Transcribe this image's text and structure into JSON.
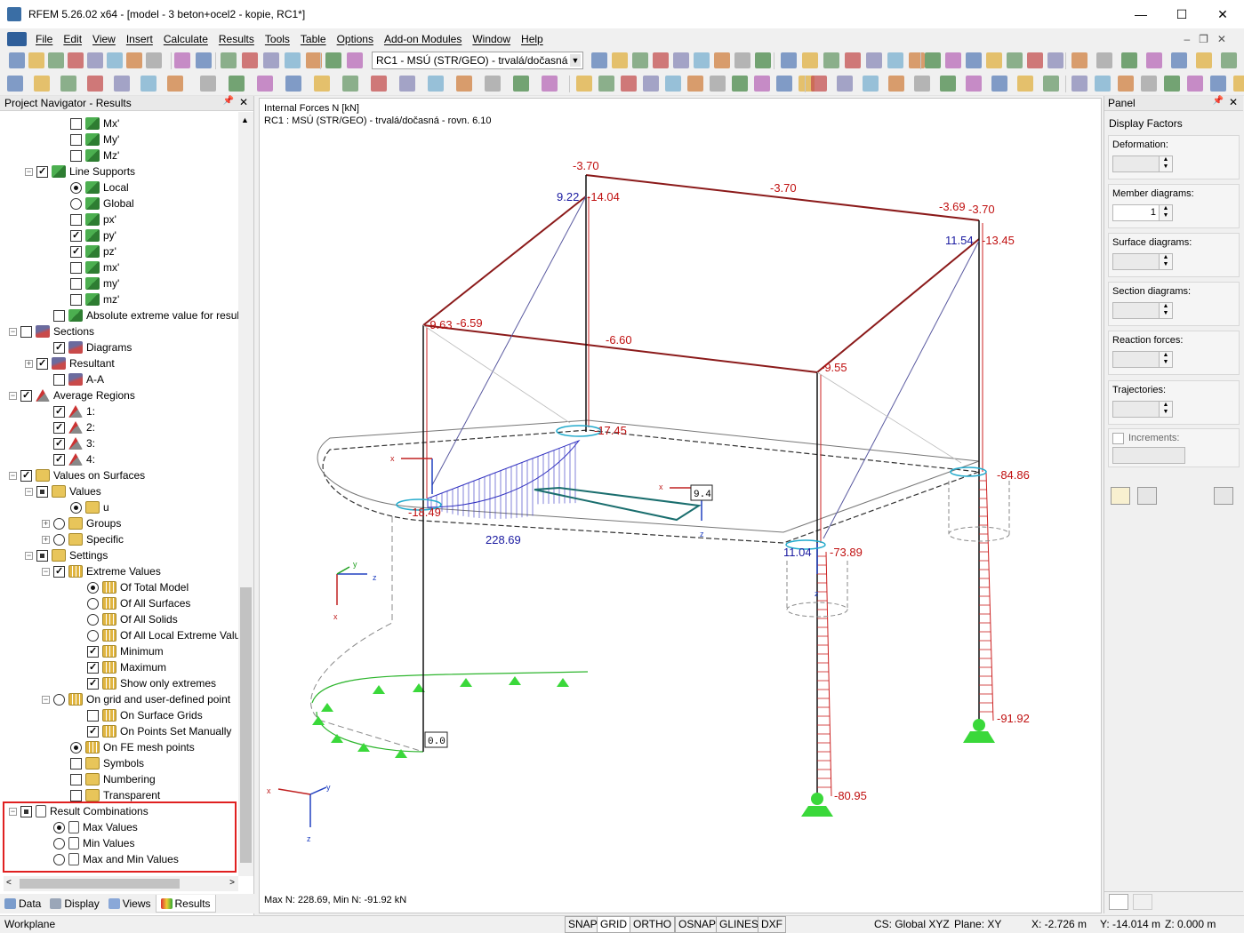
{
  "window": {
    "title": "RFEM 5.26.02 x64 - [model - 3 beton+ocel2 - kopie, RC1*]",
    "controls": [
      "—",
      "☐",
      "✕"
    ]
  },
  "menu": [
    "File",
    "Edit",
    "View",
    "Insert",
    "Calculate",
    "Results",
    "Tools",
    "Table",
    "Options",
    "Add-on Modules",
    "Window",
    "Help"
  ],
  "toolbar": {
    "load_case": "RC1 - MSÚ (STR/GEO) - trvalá/dočasná"
  },
  "navigator": {
    "title": "Project Navigator - Results",
    "items": {
      "mx": "Mx'",
      "my": "My'",
      "mz": "Mz'",
      "line_supports": "Line Supports",
      "local": "Local",
      "global": "Global",
      "px": "px'",
      "py": "py'",
      "pz": "pz'",
      "mx2": "mx'",
      "my2": "my'",
      "mz2": "mz'",
      "absolute": "Absolute extreme value for result c",
      "sections": "Sections",
      "diagrams": "Diagrams",
      "resultant": "Resultant",
      "aa": "A-A",
      "avg_regions": "Average Regions",
      "r1": "1:",
      "r2": "2:",
      "r3": "3:",
      "r4": "4:",
      "values_on_surfaces": "Values on Surfaces",
      "values": "Values",
      "u": "u",
      "groups": "Groups",
      "specific": "Specific",
      "settings": "Settings",
      "extreme_values": "Extreme Values",
      "of_total_model": "Of Total Model",
      "of_all_surfaces": "Of All Surfaces",
      "of_all_solids": "Of All Solids",
      "of_all_local": "Of All Local Extreme Values",
      "minimum": "Minimum",
      "maximum": "Maximum",
      "show_only_extremes": "Show only extremes",
      "on_grid": "On grid and user-defined point",
      "on_surface_grids": "On Surface Grids",
      "on_points_set": "On Points Set Manually",
      "on_fe_mesh": "On FE mesh points",
      "symbols": "Symbols",
      "numbering": "Numbering",
      "transparent": "Transparent",
      "result_combinations": "Result Combinations",
      "max_values": "Max Values",
      "min_values": "Min Values",
      "max_and_min": "Max and Min Values"
    },
    "tabs": [
      "Data",
      "Display",
      "Views",
      "Results"
    ]
  },
  "view": {
    "header_line1": "Internal Forces N [kN]",
    "header_line2": "RC1 : MSÚ (STR/GEO) - trvalá/dočasná - rovn. 6.10",
    "footer": "Max N: 228.69, Min N: -91.92 kN",
    "labels": {
      "a1": "-3.70",
      "a2": "-3.70",
      "a3": "-3.69",
      "a4": "-3.70",
      "b1": "9.22",
      "b2": "-14.04",
      "c1": "11.54",
      "c2": "-13.45",
      "d1": "-9.63",
      "d2": "-6.59",
      "d3": "-6.60",
      "d4": "-9.55",
      "e1": "-17.45",
      "e2": "-18.49",
      "e3": "228.69",
      "e4": "-84.86",
      "f1": "11.04",
      "f2": "-73.89",
      "g1": "-91.92",
      "g2": "-80.95",
      "box1": "9.4",
      "box2": "0.0",
      "ax_x": "x",
      "ax_y": "y",
      "ax_z": "z"
    }
  },
  "panel": {
    "title": "Panel",
    "section": "Display Factors",
    "deformation": "Deformation:",
    "member_diagrams": "Member diagrams:",
    "member_value": "1",
    "surface_diagrams": "Surface diagrams:",
    "section_diagrams": "Section diagrams:",
    "reaction_forces": "Reaction forces:",
    "trajectories": "Trajectories:",
    "increments": "Increments:"
  },
  "status": {
    "workplane": "Workplane",
    "modes": [
      "SNAP",
      "GRID",
      "ORTHO",
      "OSNAP",
      "GLINES",
      "DXF"
    ],
    "cs": "CS: Global XYZ",
    "plane": "Plane: XY",
    "x": "X:  -2.726 m",
    "y": "Y:  -14.014 m",
    "z": "Z:  0.000 m"
  }
}
